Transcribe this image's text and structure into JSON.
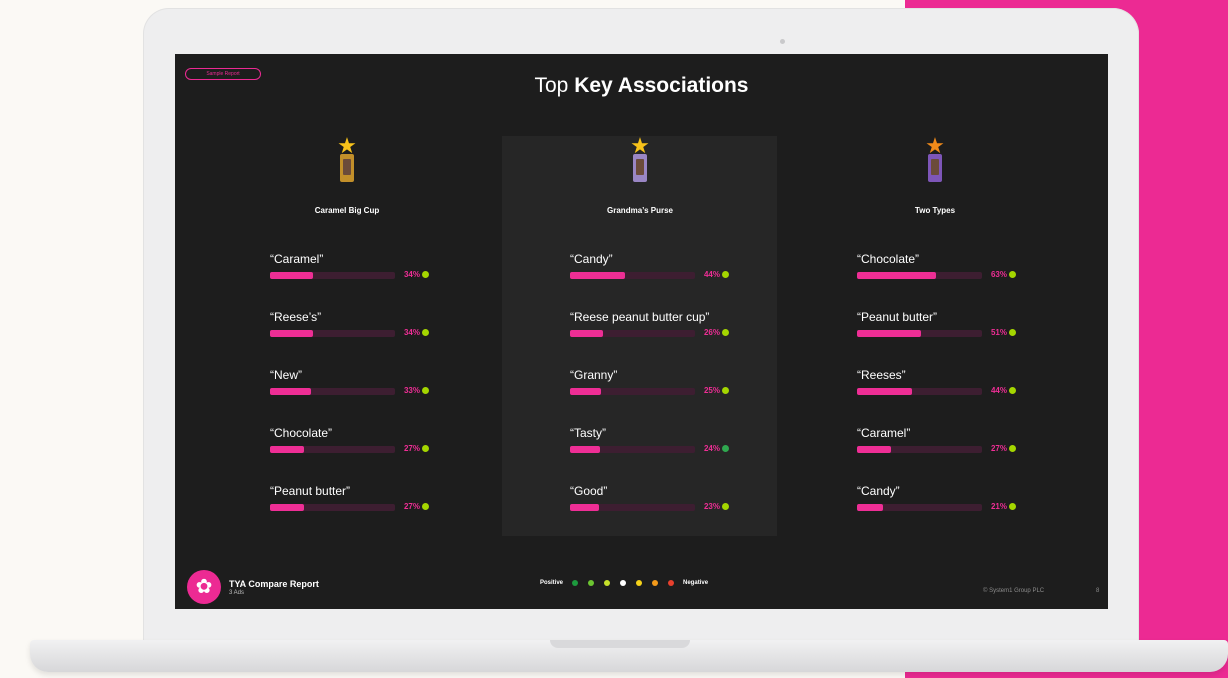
{
  "slide": {
    "tag_label": "Sample Report",
    "title_light": "Top ",
    "title_bold": "Key Associations"
  },
  "columns": [
    {
      "ad_name": "Caramel Big Cup",
      "associations": [
        {
          "label": "“Caramel”",
          "percent": 34,
          "percent_text": "34%",
          "dot_color": "#a4d600"
        },
        {
          "label": "“Reese’s”",
          "percent": 34,
          "percent_text": "34%",
          "dot_color": "#a4d600"
        },
        {
          "label": "“New”",
          "percent": 33,
          "percent_text": "33%",
          "dot_color": "#a4d600"
        },
        {
          "label": "“Chocolate”",
          "percent": 27,
          "percent_text": "27%",
          "dot_color": "#a4d600"
        },
        {
          "label": "“Peanut butter”",
          "percent": 27,
          "percent_text": "27%",
          "dot_color": "#a4d600"
        }
      ]
    },
    {
      "ad_name": "Grandma’s Purse",
      "associations": [
        {
          "label": "“Candy”",
          "percent": 44,
          "percent_text": "44%",
          "dot_color": "#a4d600"
        },
        {
          "label": "“Reese peanut butter cup”",
          "percent": 26,
          "percent_text": "26%",
          "dot_color": "#a4d600"
        },
        {
          "label": "“Granny”",
          "percent": 25,
          "percent_text": "25%",
          "dot_color": "#a4d600"
        },
        {
          "label": "“Tasty”",
          "percent": 24,
          "percent_text": "24%",
          "dot_color": "#2fa84f"
        },
        {
          "label": "“Good”",
          "percent": 23,
          "percent_text": "23%",
          "dot_color": "#a4d600"
        }
      ]
    },
    {
      "ad_name": "Two Types",
      "associations": [
        {
          "label": "“Chocolate”",
          "percent": 63,
          "percent_text": "63%",
          "dot_color": "#a4d600"
        },
        {
          "label": "“Peanut butter”",
          "percent": 51,
          "percent_text": "51%",
          "dot_color": "#a4d600"
        },
        {
          "label": "“Reeses”",
          "percent": 44,
          "percent_text": "44%",
          "dot_color": "#a4d600"
        },
        {
          "label": "“Caramel”",
          "percent": 27,
          "percent_text": "27%",
          "dot_color": "#a4d600"
        },
        {
          "label": "“Candy”",
          "percent": 21,
          "percent_text": "21%",
          "dot_color": "#a4d600"
        }
      ]
    }
  ],
  "footer": {
    "report_title": "TYA Compare Report",
    "report_subtitle": "3 Ads",
    "legend_positive": "Positive",
    "legend_negative": "Negative",
    "legend_colors": [
      "#1d9a3e",
      "#6cc531",
      "#c6e02a",
      "#ffffff",
      "#f5d21a",
      "#f39a1a",
      "#e8402d"
    ],
    "copyright": "© System1 Group PLC",
    "page_number": "8"
  },
  "colors": {
    "accent_pink": "#ec2a93",
    "screen_bg": "#1d1d1d"
  }
}
